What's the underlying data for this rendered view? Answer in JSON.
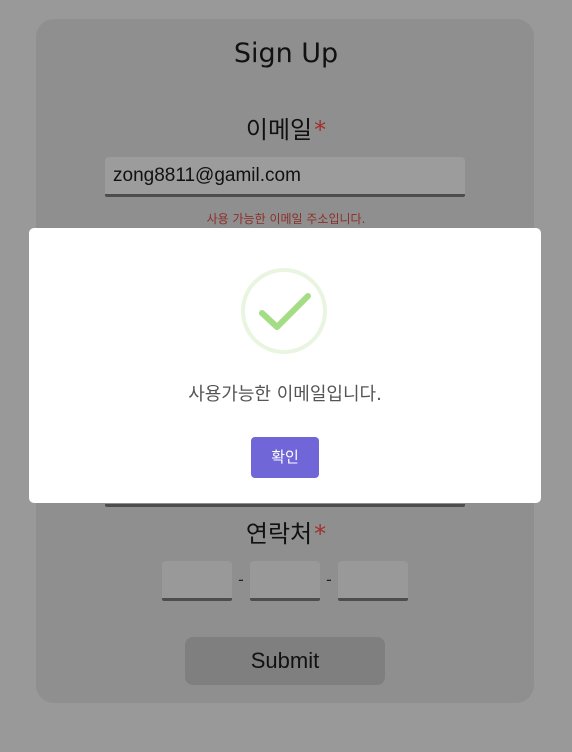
{
  "form": {
    "title": "Sign Up",
    "email_label": "이메일",
    "required_mark": "*",
    "email_value": "zong8811@gamil.com",
    "email_hint": "사용 가능한 이메일 주소입니다.",
    "phone_label": "연락처",
    "phone_separator": "-",
    "submit_label": "Submit"
  },
  "modal": {
    "message": "사용가능한 이메일입니다.",
    "confirm_label": "확인",
    "icon": "check-circle-icon"
  },
  "colors": {
    "overlay": "#999999",
    "accent": "#7066d8",
    "success": "#a5dc86",
    "required": "#a0302a"
  }
}
